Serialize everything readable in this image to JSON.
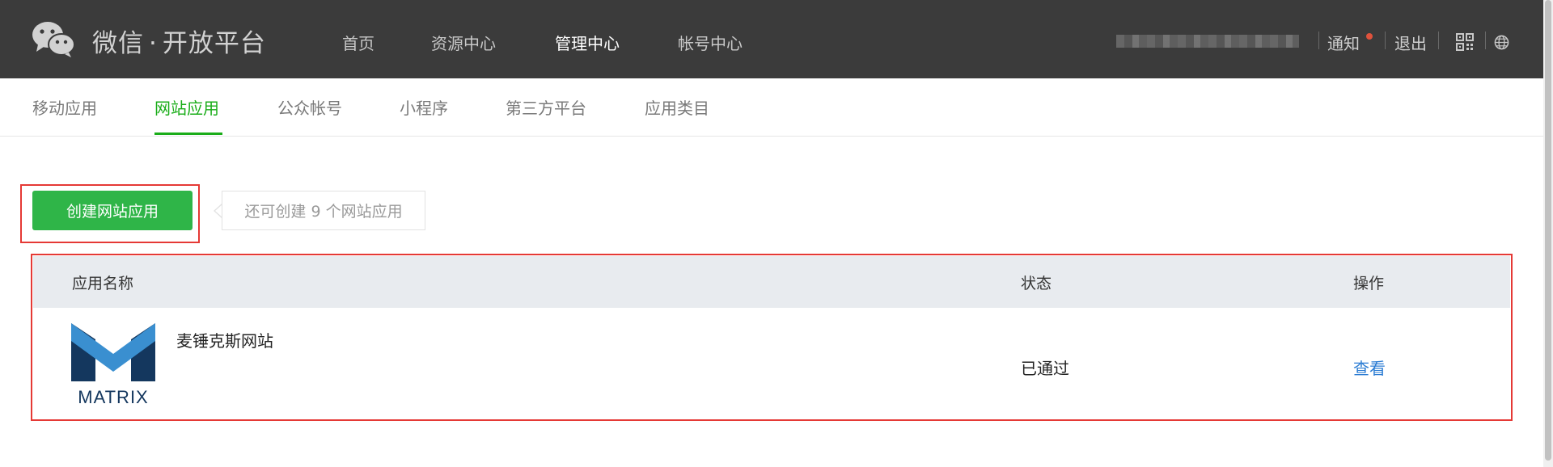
{
  "header": {
    "brand_name": "微信",
    "brand_dot": "·",
    "brand_suffix": "开放平台",
    "nav": [
      {
        "label": "首页"
      },
      {
        "label": "资源中心"
      },
      {
        "label": "管理中心"
      },
      {
        "label": "帐号中心"
      }
    ],
    "active_nav": "管理中心",
    "notice_label": "通知",
    "logout_label": "退出",
    "icons": [
      "wechat-logo-icon",
      "qrcode-icon",
      "globe-icon"
    ]
  },
  "subtabs": {
    "items": [
      {
        "label": "移动应用"
      },
      {
        "label": "网站应用"
      },
      {
        "label": "公众帐号"
      },
      {
        "label": "小程序"
      },
      {
        "label": "第三方平台"
      },
      {
        "label": "应用类目"
      }
    ],
    "active": "网站应用"
  },
  "create": {
    "button_label": "创建网站应用",
    "tip_text": "还可创建 9 个网站应用"
  },
  "table": {
    "columns": [
      "应用名称",
      "状态",
      "操作"
    ],
    "rows": [
      {
        "logo_text": "MATRIX",
        "name": "麦锤克斯网站",
        "status": "已通过",
        "action": "查看"
      }
    ]
  },
  "colors": {
    "header_bg": "#3b3b3b",
    "accent_green": "#1aad19",
    "button_green": "#2fb548",
    "highlight_red": "#e53935",
    "link_blue": "#2b7cd3",
    "table_header_bg": "#e8ebef"
  }
}
